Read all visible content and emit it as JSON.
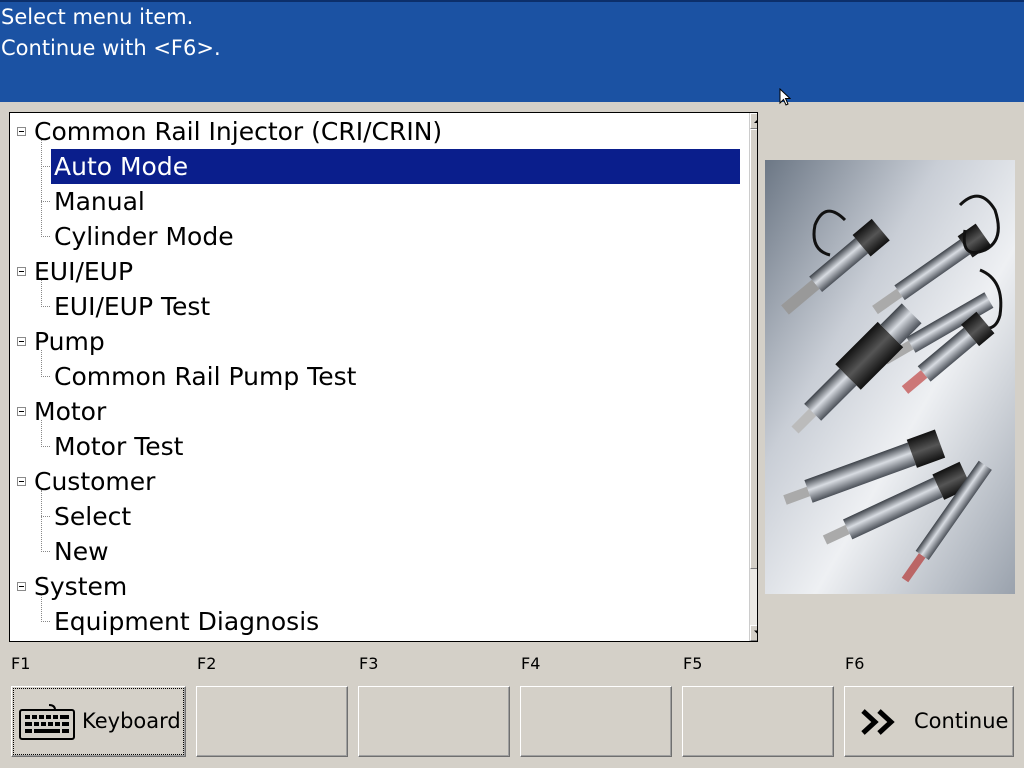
{
  "header": {
    "line1": "Select menu item.",
    "line2": "Continue with <F6>."
  },
  "tree": {
    "items": [
      {
        "label": "Common Rail Injector (CRI/CRIN)",
        "level": 0,
        "selected": false
      },
      {
        "label": "Auto Mode",
        "level": 1,
        "selected": true
      },
      {
        "label": "Manual",
        "level": 1,
        "selected": false
      },
      {
        "label": "Cylinder Mode",
        "level": 1,
        "selected": false
      },
      {
        "label": "EUI/EUP",
        "level": 0,
        "selected": false
      },
      {
        "label": "EUI/EUP Test",
        "level": 1,
        "selected": false
      },
      {
        "label": "Pump",
        "level": 0,
        "selected": false
      },
      {
        "label": "Common Rail Pump Test",
        "level": 1,
        "selected": false
      },
      {
        "label": "Motor",
        "level": 0,
        "selected": false
      },
      {
        "label": "Motor Test",
        "level": 1,
        "selected": false
      },
      {
        "label": "Customer",
        "level": 0,
        "selected": false
      },
      {
        "label": "Select",
        "level": 1,
        "selected": false
      },
      {
        "label": "New",
        "level": 1,
        "selected": false
      },
      {
        "label": "System",
        "level": 0,
        "selected": false
      },
      {
        "label": "Equipment Diagnosis",
        "level": 1,
        "selected": false
      }
    ]
  },
  "image": {
    "subject": "diesel-injectors-photo"
  },
  "fkeys": [
    {
      "key": "F1",
      "label": "Keyboard",
      "icon": "keyboard-icon"
    },
    {
      "key": "F2",
      "label": "",
      "icon": ""
    },
    {
      "key": "F3",
      "label": "",
      "icon": ""
    },
    {
      "key": "F4",
      "label": "",
      "icon": ""
    },
    {
      "key": "F5",
      "label": "",
      "icon": ""
    },
    {
      "key": "F6",
      "label": "Continue",
      "icon": "double-chevron-right-icon"
    }
  ],
  "colors": {
    "header_bg": "#1b52a3",
    "selection_bg": "#0a1e8c",
    "window_bg": "#d4d0c8"
  }
}
